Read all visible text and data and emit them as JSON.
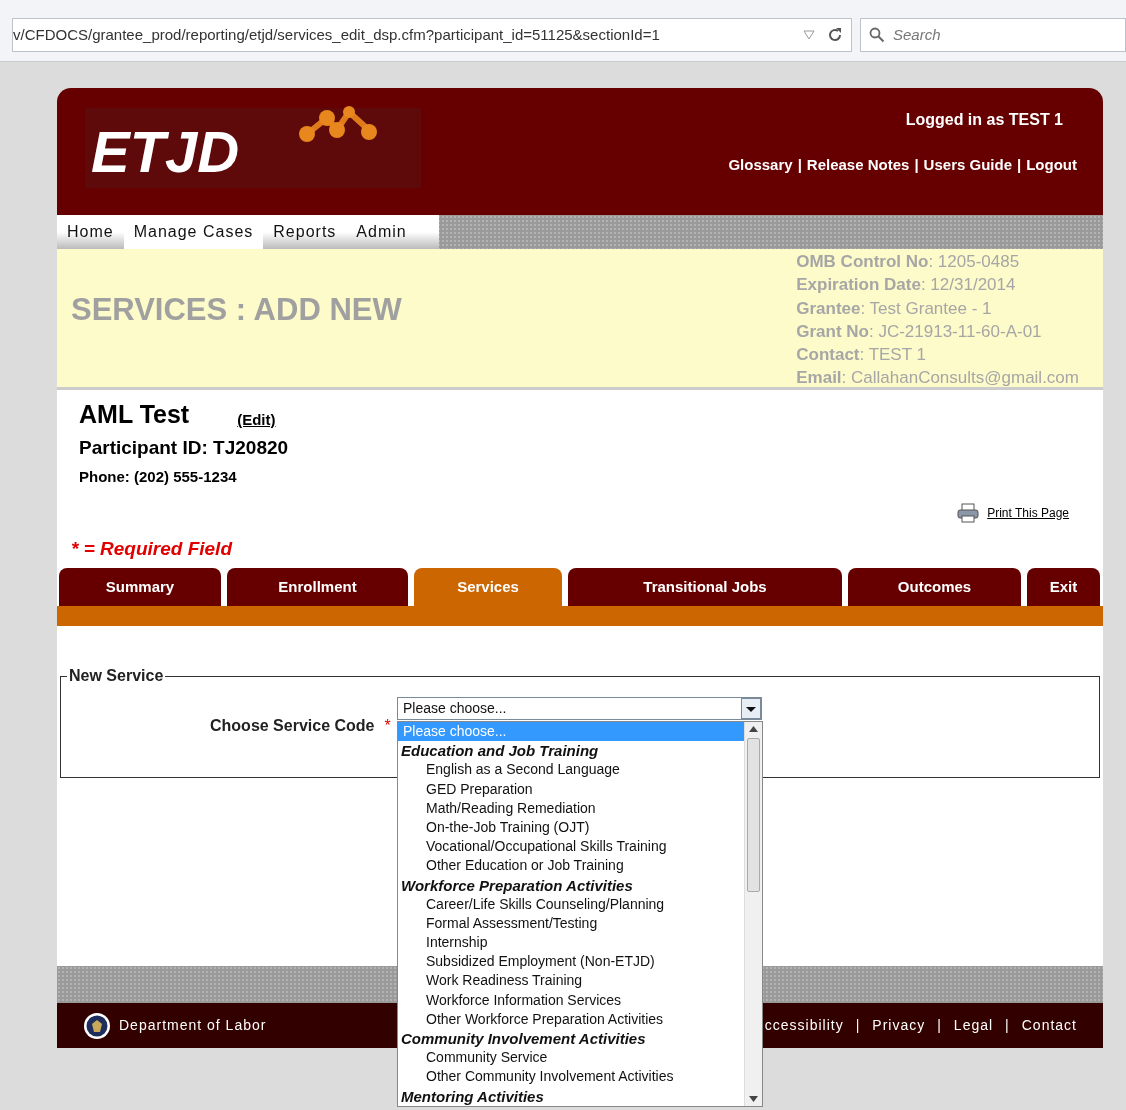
{
  "browser": {
    "url": "v/CFDOCS/grantee_prod/reporting/etjd/services_edit_dsp.cfm?participant_id=51125&sectionId=1",
    "search_placeholder": "Search"
  },
  "header": {
    "logo": "ETJD",
    "logged_in": "Logged in as TEST 1",
    "separator": "|",
    "links": [
      "Glossary",
      "Release Notes",
      "Users Guide",
      "Logout"
    ]
  },
  "nav": [
    {
      "label": "Home",
      "selected": false
    },
    {
      "label": "Manage Cases",
      "selected": true
    },
    {
      "label": "Reports",
      "selected": false
    },
    {
      "label": "Admin",
      "selected": false
    }
  ],
  "banner": {
    "title": "SERVICES : ADD NEW",
    "info": [
      {
        "label": "OMB Control No",
        "value": ": 1205-0485"
      },
      {
        "label": "Expiration Date",
        "value": ": 12/31/2014"
      },
      {
        "label": "Grantee",
        "value": ": Test Grantee - 1"
      },
      {
        "label": "Grant No",
        "value": ": JC-21913-11-60-A-01"
      },
      {
        "label": "Contact",
        "value": ": TEST 1"
      },
      {
        "label": "Email",
        "value": ": CallahanConsults@gmail.com"
      }
    ]
  },
  "participant": {
    "name": "AML Test",
    "edit": "(Edit)",
    "id_line": "Participant ID: TJ20820",
    "phone": "Phone: (202) 555-1234"
  },
  "print": "Print This Page",
  "required_note": "* = Required Field",
  "tabs": [
    {
      "label": "Summary",
      "selected": false
    },
    {
      "label": "Enrollment",
      "selected": false
    },
    {
      "label": "Services",
      "selected": true
    },
    {
      "label": "Transitional Jobs",
      "selected": false
    },
    {
      "label": "Outcomes",
      "selected": false
    },
    {
      "label": "Exit",
      "selected": false
    }
  ],
  "form": {
    "legend": "New Service",
    "label": "Choose Service Code",
    "required_mark": "*",
    "value": "Please choose...",
    "options": [
      {
        "kind": "option",
        "label": "Please choose...",
        "selected": true
      },
      {
        "kind": "group",
        "label": "Education and Job Training",
        "selected": false
      },
      {
        "kind": "option",
        "label": "English as a Second Language",
        "selected": false
      },
      {
        "kind": "option",
        "label": "GED Preparation",
        "selected": false
      },
      {
        "kind": "option",
        "label": "Math/Reading Remediation",
        "selected": false
      },
      {
        "kind": "option",
        "label": "On-the-Job Training (OJT)",
        "selected": false
      },
      {
        "kind": "option",
        "label": "Vocational/Occupational Skills Training",
        "selected": false
      },
      {
        "kind": "option",
        "label": "Other Education or Job Training",
        "selected": false
      },
      {
        "kind": "group",
        "label": "Workforce Preparation Activities",
        "selected": false
      },
      {
        "kind": "option",
        "label": "Career/Life Skills Counseling/Planning",
        "selected": false
      },
      {
        "kind": "option",
        "label": "Formal Assessment/Testing",
        "selected": false
      },
      {
        "kind": "option",
        "label": "Internship",
        "selected": false
      },
      {
        "kind": "option",
        "label": "Subsidized Employment (Non-ETJD)",
        "selected": false
      },
      {
        "kind": "option",
        "label": "Work Readiness Training",
        "selected": false
      },
      {
        "kind": "option",
        "label": "Workforce Information Services",
        "selected": false
      },
      {
        "kind": "option",
        "label": "Other Workforce Preparation Activities",
        "selected": false
      },
      {
        "kind": "group",
        "label": "Community Involvement Activities",
        "selected": false
      },
      {
        "kind": "option",
        "label": "Community Service",
        "selected": false
      },
      {
        "kind": "option",
        "label": "Other Community Involvement Activities",
        "selected": false
      },
      {
        "kind": "group",
        "label": "Mentoring Activities",
        "selected": false
      }
    ]
  },
  "footer": {
    "agency": "Department of Labor",
    "separator": "|",
    "links": [
      "ccessibility",
      "Privacy",
      "Legal",
      "Contact"
    ]
  }
}
